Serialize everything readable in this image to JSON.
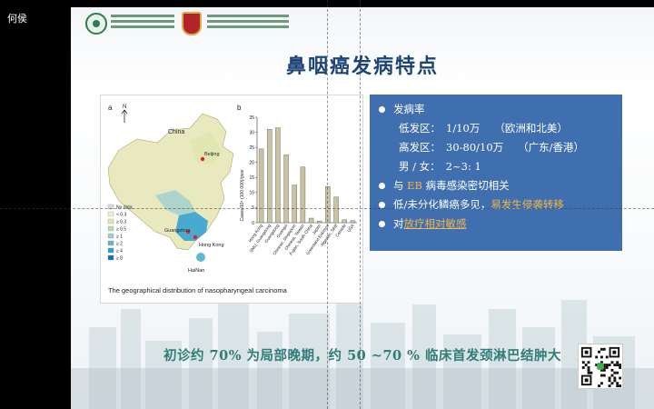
{
  "presenter": {
    "name": "何侯"
  },
  "slide": {
    "title": "鼻咽癌发病特点",
    "info": {
      "lines": [
        {
          "type": "bullet",
          "text": "发病率"
        },
        {
          "type": "indent",
          "label": "低发区：",
          "value": "1/10万",
          "note": "（欧洲和北美）"
        },
        {
          "type": "indent",
          "label": "高发区：",
          "value": "30-80/10万",
          "note": "（广东/香港）"
        },
        {
          "type": "indent",
          "label": "男 / 女：",
          "value": "2~3: 1"
        },
        {
          "type": "bullet",
          "pre": "与 ",
          "highlight": "EB",
          "post": " 病毒感染密切相关"
        },
        {
          "type": "bullet",
          "pre": "低/未分化鳞癌多见，",
          "highlight": "易发生侵袭转移",
          "post": ""
        },
        {
          "type": "bullet",
          "pre": "对",
          "highlight": "放疗相对敏感",
          "post": ""
        }
      ]
    },
    "bottom_text": "初诊约 70% 为局部晚期，约 50 ~70 % 临床首发颈淋巴结肿大",
    "figure": {
      "caption": "The geographical distribution of nasopharyngeal carcinoma",
      "panel_a_label": "a",
      "panel_b_label": "b",
      "north_label": "N",
      "map_labels": {
        "china": "China",
        "beijing": "Beijing",
        "guangzhou": "Guangzhou",
        "hongkong": "Hong Kong",
        "hainan": "HaiNan"
      },
      "map_legend": [
        "No data",
        "< 0.3",
        "≥ 0.3",
        "≥ 0.5",
        "≥ 1",
        "≥ 2",
        "≥ 4",
        "≥ 8"
      ],
      "map_legend_colors": [
        "#d9d9d9",
        "#f2efc4",
        "#dfe7b0",
        "#bcd9b6",
        "#9fd0cf",
        "#5fb8d8",
        "#2c9fd1",
        "#0a76b8"
      ]
    }
  },
  "chart_data": {
    "type": "bar",
    "title": "",
    "ylabel": "Cases/10⁵ (100 000)/year",
    "xlabel": "",
    "ylim": [
      0,
      35
    ],
    "yticks": [
      0,
      5,
      10,
      15,
      20,
      25,
      30,
      35
    ],
    "categories": [
      "Hong Kong",
      "SMU, Guangdong",
      "Guangdong",
      "Guangxi",
      "Chinese, Singapore",
      "Chinese, Taiwan",
      "Fujian, South China",
      "Japan",
      "Greenland Eskimos",
      "Algerian, Sétif",
      "Canada",
      "USA"
    ],
    "values": [
      24.5,
      31,
      31.5,
      22.5,
      12.5,
      18.5,
      1.5,
      0.5,
      12,
      8.5,
      1,
      0.7
    ],
    "bar_color": "#c9c3a1",
    "bar_stroke": "#5a5a5a",
    "grid": false
  },
  "colors": {
    "title": "#1d4477",
    "info_box": "#3f6fae",
    "highlight": "#f3b648",
    "bottom_text": "#2f7d78"
  },
  "icons": {
    "logo_left": "hospital-emblem-icon",
    "logo_right": "university-crest-icon",
    "qr": "qr-code-icon"
  }
}
